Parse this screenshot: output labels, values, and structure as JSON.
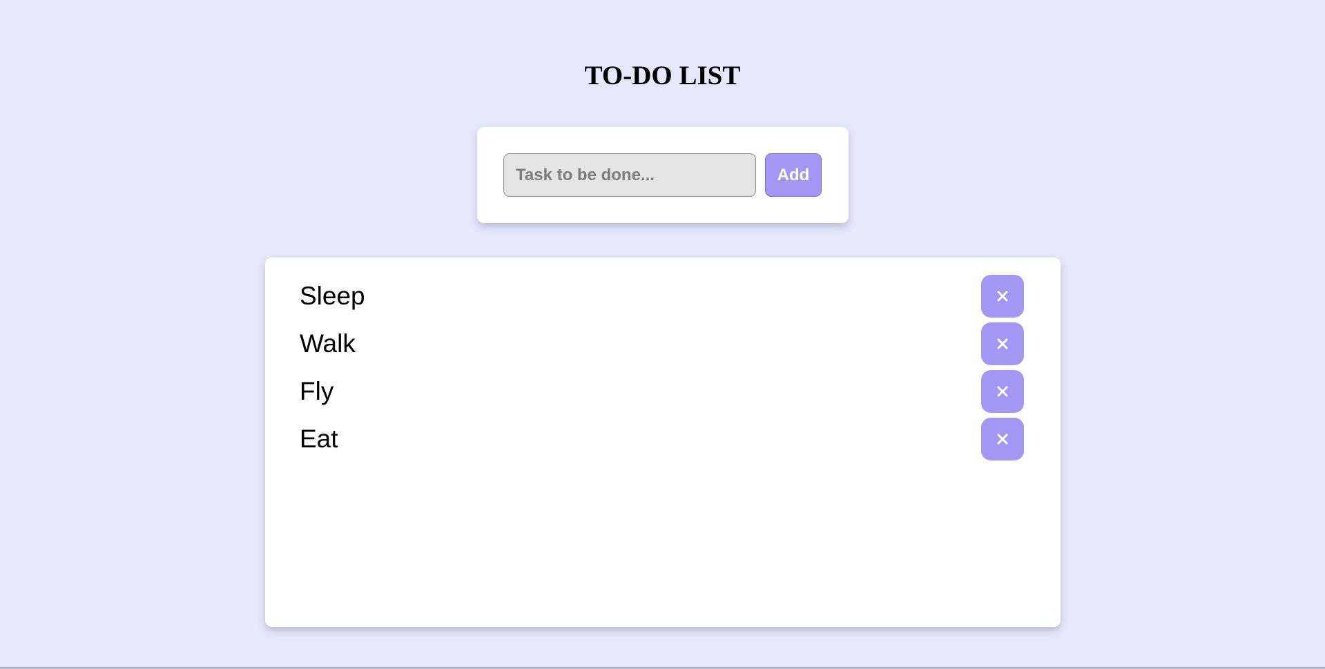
{
  "header": {
    "title": "TO-DO LIST"
  },
  "input_card": {
    "task_input": {
      "value": "",
      "placeholder": "Task to be done..."
    },
    "add_label": "Add"
  },
  "tasks": [
    {
      "text": "Sleep",
      "delete_icon": "close-icon"
    },
    {
      "text": "Walk",
      "delete_icon": "close-icon"
    },
    {
      "text": "Fly",
      "delete_icon": "close-icon"
    },
    {
      "text": "Eat",
      "delete_icon": "close-icon"
    }
  ],
  "colors": {
    "background": "#e6e6fc",
    "accent": "#a496f3",
    "card": "#ffffff",
    "input_background": "#e4e4e4"
  }
}
